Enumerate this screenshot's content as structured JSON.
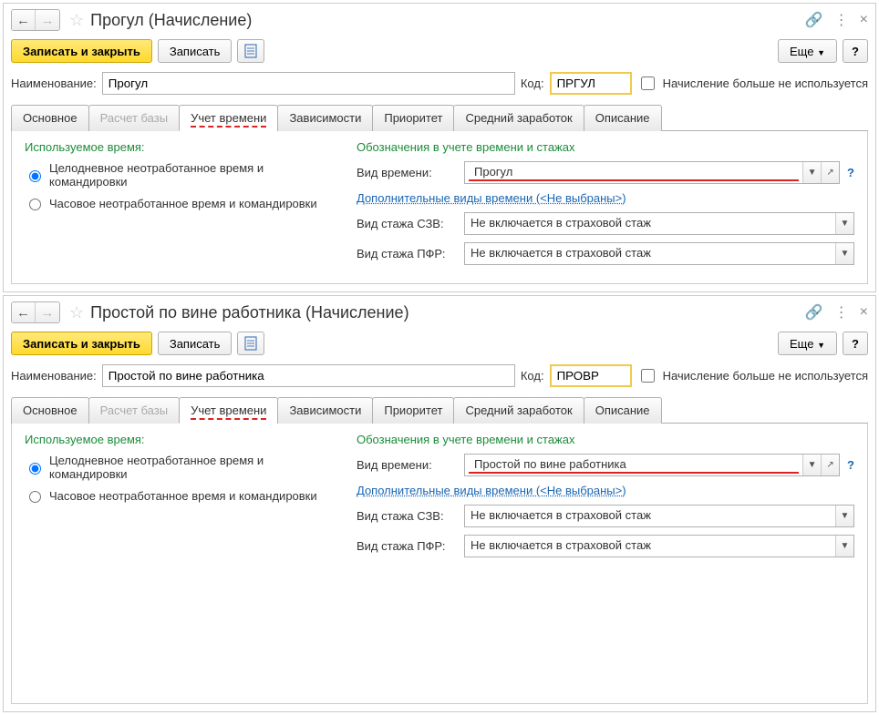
{
  "windows": [
    {
      "title": "Прогул (Начисление)",
      "toolbar": {
        "save_close": "Записать и закрыть",
        "save": "Записать",
        "more": "Еще"
      },
      "name_label": "Наименование:",
      "name_value": "Прогул",
      "code_label": "Код:",
      "code_value": "ПРГУЛ",
      "not_used_label": "Начисление больше не используется",
      "tabs": [
        "Основное",
        "Расчет базы",
        "Учет времени",
        "Зависимости",
        "Приоритет",
        "Средний заработок",
        "Описание"
      ],
      "left_header": "Используемое время:",
      "radio1": "Целодневное неотработанное время и командировки",
      "radio2": "Часовое неотработанное время и командировки",
      "right_header": "Обозначения в учете времени и стажах",
      "vid_vremeni_label": "Вид времени:",
      "vid_vremeni_value": "Прогул",
      "extra_link": "Дополнительные виды времени (<Не выбраны>)",
      "staj_szv_label": "Вид стажа СЗВ:",
      "staj_szv_value": "Не включается в страховой стаж",
      "staj_pfr_label": "Вид стажа ПФР:",
      "staj_pfr_value": "Не включается в страховой стаж"
    },
    {
      "title": "Простой по вине работника (Начисление)",
      "toolbar": {
        "save_close": "Записать и закрыть",
        "save": "Записать",
        "more": "Еще"
      },
      "name_label": "Наименование:",
      "name_value": "Простой по вине работника",
      "code_label": "Код:",
      "code_value": "ПРОВР",
      "not_used_label": "Начисление больше не используется",
      "tabs": [
        "Основное",
        "Расчет базы",
        "Учет времени",
        "Зависимости",
        "Приоритет",
        "Средний заработок",
        "Описание"
      ],
      "left_header": "Используемое время:",
      "radio1": "Целодневное неотработанное время и командировки",
      "radio2": "Часовое неотработанное время и командировки",
      "right_header": "Обозначения в учете времени и стажах",
      "vid_vremeni_label": "Вид времени:",
      "vid_vremeni_value": "Простой по вине работника",
      "extra_link": "Дополнительные виды времени (<Не выбраны>)",
      "staj_szv_label": "Вид стажа СЗВ:",
      "staj_szv_value": "Не включается в страховой стаж",
      "staj_pfr_label": "Вид стажа ПФР:",
      "staj_pfr_value": "Не включается в страховой стаж"
    }
  ]
}
